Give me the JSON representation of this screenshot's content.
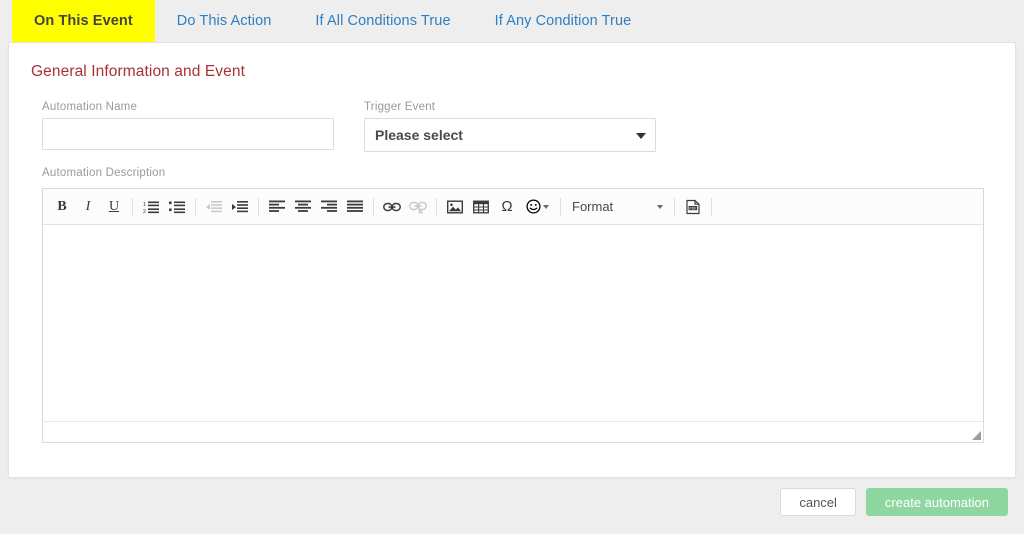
{
  "tabs": [
    {
      "label": "On This Event",
      "active": true
    },
    {
      "label": "Do This Action",
      "active": false
    },
    {
      "label": "If All Conditions True",
      "active": false
    },
    {
      "label": "If Any Condition True",
      "active": false
    }
  ],
  "card": {
    "section_title": "General Information and Event",
    "automation_name": {
      "label": "Automation Name",
      "value": "",
      "placeholder": ""
    },
    "trigger_event": {
      "label": "Trigger Event",
      "selected": "Please select"
    },
    "automation_description": {
      "label": "Automation Description",
      "value": ""
    }
  },
  "toolbar": {
    "bold": "B",
    "italic": "I",
    "underline": "U",
    "omega": "Ω",
    "smiley": "☺",
    "format_label": "Format",
    "items": [
      {
        "name": "bold-icon",
        "enabled": true
      },
      {
        "name": "italic-icon",
        "enabled": true
      },
      {
        "name": "underline-icon",
        "enabled": true
      },
      {
        "name": "numbered-list-icon",
        "enabled": true
      },
      {
        "name": "bulleted-list-icon",
        "enabled": true
      },
      {
        "name": "decrease-indent-icon",
        "enabled": false
      },
      {
        "name": "increase-indent-icon",
        "enabled": true
      },
      {
        "name": "align-left-icon",
        "enabled": true
      },
      {
        "name": "align-center-icon",
        "enabled": true
      },
      {
        "name": "align-right-icon",
        "enabled": true
      },
      {
        "name": "align-justify-icon",
        "enabled": true
      },
      {
        "name": "link-icon",
        "enabled": true
      },
      {
        "name": "unlink-icon",
        "enabled": false
      },
      {
        "name": "image-icon",
        "enabled": true
      },
      {
        "name": "table-icon",
        "enabled": true
      },
      {
        "name": "special-character-icon",
        "enabled": true
      },
      {
        "name": "emoji-icon",
        "enabled": true
      },
      {
        "name": "format-dropdown",
        "enabled": true
      },
      {
        "name": "pdf-icon",
        "enabled": true
      }
    ]
  },
  "footer": {
    "cancel_label": "cancel",
    "create_label": "create automation"
  },
  "colors": {
    "page_background": "#eeeeee",
    "card_background": "#ffffff",
    "tab_link": "#2d7fc1",
    "tab_active_highlight": "#ffff00",
    "section_title": "#a83232",
    "create_button": "#8fd6a0",
    "label_text": "#9a9a9a"
  }
}
